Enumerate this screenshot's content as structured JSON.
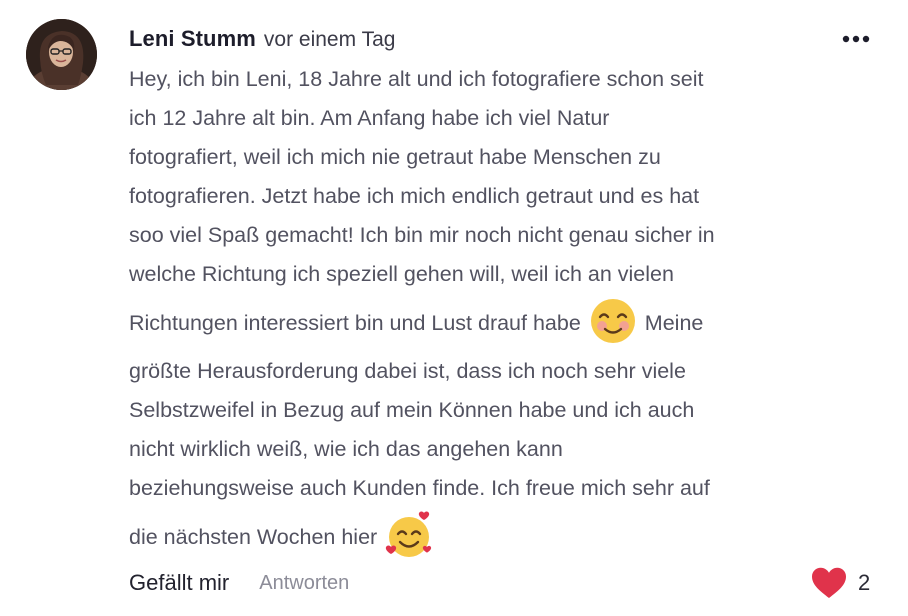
{
  "comment": {
    "author": "Leni Stumm",
    "time": "vor einem Tag",
    "more_icon": "more-horizontal-icon",
    "avatar_icon": "user-avatar",
    "body": {
      "line1": "Hey, ich bin Leni, 18 Jahre alt und ich fotografiere schon seit",
      "line2": "ich 12 Jahre alt bin. Am Anfang habe ich viel Natur",
      "line3": "fotografiert, weil ich mich nie getraut habe Menschen zu",
      "line4": "fotografieren. Jetzt habe ich mich endlich getraut und es hat",
      "line5": "soo viel Spaß gemacht! Ich bin mir noch nicht genau sicher in",
      "line6": "welche Richtung ich speziell gehen will, weil ich an vielen",
      "line7a": "Richtungen interessiert bin und Lust drauf habe",
      "line7b": "Meine",
      "line8": "größte Herausforderung dabei ist, dass ich noch sehr viele",
      "line9": "Selbstzweifel in Bezug auf mein Können habe und ich auch",
      "line10": "nicht wirklich weiß, wie ich das angehen kann",
      "line11": "beziehungsweise auch Kunden finde. Ich freue mich sehr auf",
      "line12": "die nächsten Wochen hier",
      "emoji1": "smiling-blushing-face-emoji",
      "emoji2": "smiling-face-with-hearts-emoji"
    },
    "actions": {
      "like_label": "Gefällt mir",
      "reply_label": "Antworten"
    },
    "reactions": {
      "icon": "heart-icon",
      "count": "2"
    },
    "colors": {
      "author": "#1d1d2b",
      "body_text": "#525260",
      "muted": "#8c8c98",
      "heart": "#e0334b",
      "emoji_yellow": "#f7c948"
    }
  }
}
